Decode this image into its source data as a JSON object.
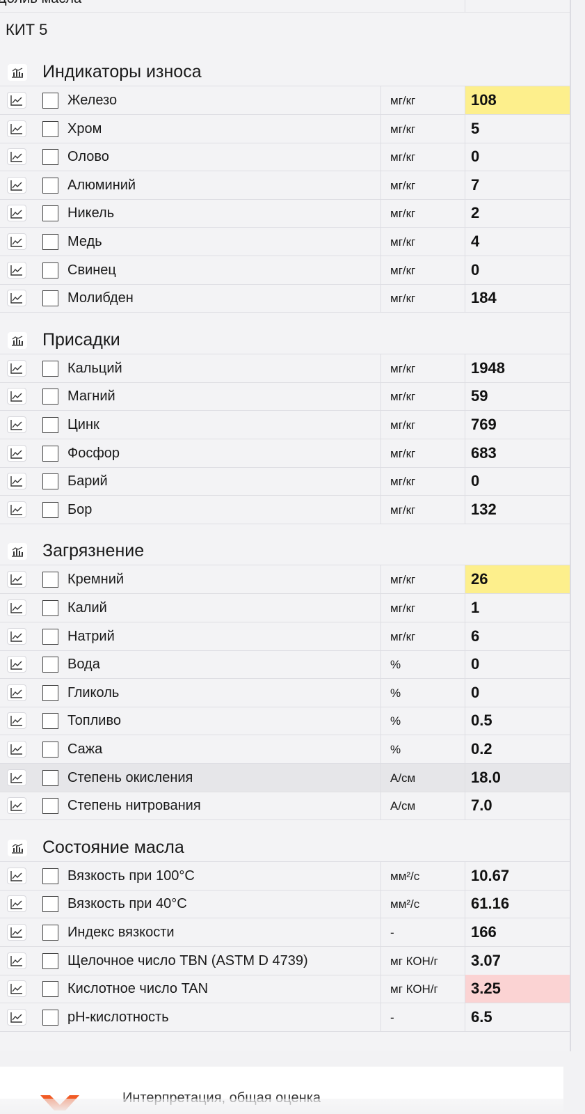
{
  "header": {
    "prev_row_label": "Долив масла",
    "kit_label": "КИТ 5"
  },
  "sections": [
    {
      "title": "Индикаторы износа",
      "rows": [
        {
          "name": "Железо",
          "unit": "мг/кг",
          "value": "108",
          "status": "warn"
        },
        {
          "name": "Хром",
          "unit": "мг/кг",
          "value": "5"
        },
        {
          "name": "Олово",
          "unit": "мг/кг",
          "value": "0"
        },
        {
          "name": "Алюминий",
          "unit": "мг/кг",
          "value": "7"
        },
        {
          "name": "Никель",
          "unit": "мг/кг",
          "value": "2"
        },
        {
          "name": "Медь",
          "unit": "мг/кг",
          "value": "4"
        },
        {
          "name": "Свинец",
          "unit": "мг/кг",
          "value": "0"
        },
        {
          "name": "Молибден",
          "unit": "мг/кг",
          "value": "184"
        }
      ]
    },
    {
      "title": "Присадки",
      "rows": [
        {
          "name": "Кальций",
          "unit": "мг/кг",
          "value": "1948"
        },
        {
          "name": "Магний",
          "unit": "мг/кг",
          "value": "59"
        },
        {
          "name": "Цинк",
          "unit": "мг/кг",
          "value": "769"
        },
        {
          "name": "Фосфор",
          "unit": "мг/кг",
          "value": "683"
        },
        {
          "name": "Барий",
          "unit": "мг/кг",
          "value": "0"
        },
        {
          "name": "Бор",
          "unit": "мг/кг",
          "value": "132"
        }
      ]
    },
    {
      "title": "Загрязнение",
      "rows": [
        {
          "name": "Кремний",
          "unit": "мг/кг",
          "value": "26",
          "status": "warn"
        },
        {
          "name": "Калий",
          "unit": "мг/кг",
          "value": "1"
        },
        {
          "name": "Натрий",
          "unit": "мг/кг",
          "value": "6"
        },
        {
          "name": "Вода",
          "unit": "%",
          "value": "0"
        },
        {
          "name": "Гликоль",
          "unit": "%",
          "value": "0"
        },
        {
          "name": "Топливо",
          "unit": "%",
          "value": "0.5"
        },
        {
          "name": "Сажа",
          "unit": "%",
          "value": "0.2"
        },
        {
          "name": "Степень окисления",
          "unit": "А/см",
          "value": "18.0",
          "hovered": true
        },
        {
          "name": "Степень нитрования",
          "unit": "А/см",
          "value": "7.0"
        }
      ]
    },
    {
      "title": "Состояние масла",
      "rows": [
        {
          "name": "Вязкость при 100°C",
          "unit": "мм²/с",
          "value": "10.67"
        },
        {
          "name": "Вязкость при 40°C",
          "unit": "мм²/с",
          "value": "61.16"
        },
        {
          "name": "Индекс вязкости",
          "unit": "-",
          "value": "166"
        },
        {
          "name": "Щелочное число TBN (ASTM D 4739)",
          "unit": "мг КОН/г",
          "value": "3.07"
        },
        {
          "name": "Кислотное число TAN",
          "unit": "мг КОН/г",
          "value": "3.25",
          "status": "alert"
        },
        {
          "name": "pH-кислотность",
          "unit": "-",
          "value": "6.5"
        }
      ]
    }
  ],
  "footer_card": {
    "text": "Интерпретация, общая оценка"
  },
  "colors": {
    "warn": "#fdef8c",
    "alert": "#fbd3d3",
    "brand": "#f15a24"
  },
  "icons": {
    "row_chart": "line-chart-icon",
    "section_chart": "bar-chart-icon",
    "footer_logo": "brand-logo-icon"
  }
}
